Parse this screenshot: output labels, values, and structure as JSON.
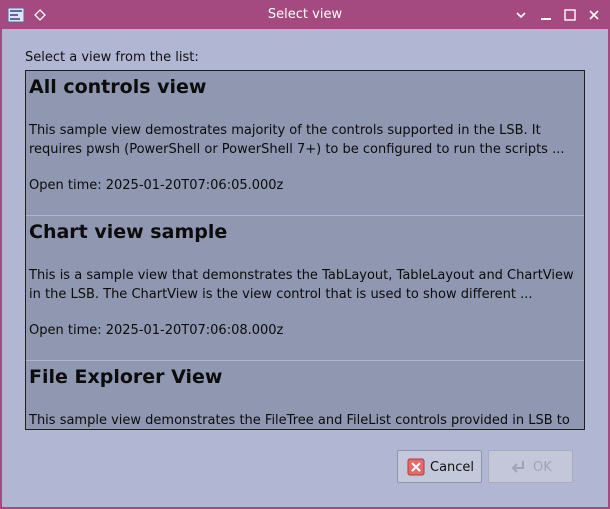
{
  "window": {
    "title": "Select view"
  },
  "prompt": "Select a view from the list:",
  "views": [
    {
      "title": "All controls view",
      "description": "This sample view demostrates majority of the controls supported in the LSB. It requires pwsh (PowerShell or PowerShell 7+) to be configured to run the scripts ...",
      "open_time": "Open time: 2025-01-20T07:06:05.000z"
    },
    {
      "title": "Chart view sample",
      "description": "This is a sample view that demonstrates the TabLayout, TableLayout and ChartView in the LSB. The ChartView is the view control that is used to show different ...",
      "open_time": "Open time: 2025-01-20T07:06:08.000z"
    },
    {
      "title": "File Explorer View",
      "description": "This sample view demonstrates the FileTree and FileList controls provided in LSB to",
      "open_time": ""
    }
  ],
  "buttons": {
    "cancel": "Cancel",
    "ok": "OK"
  },
  "colors": {
    "titlebar": "#a44a80",
    "background": "#b1b6d3",
    "list_bg": "#8f97b1"
  }
}
